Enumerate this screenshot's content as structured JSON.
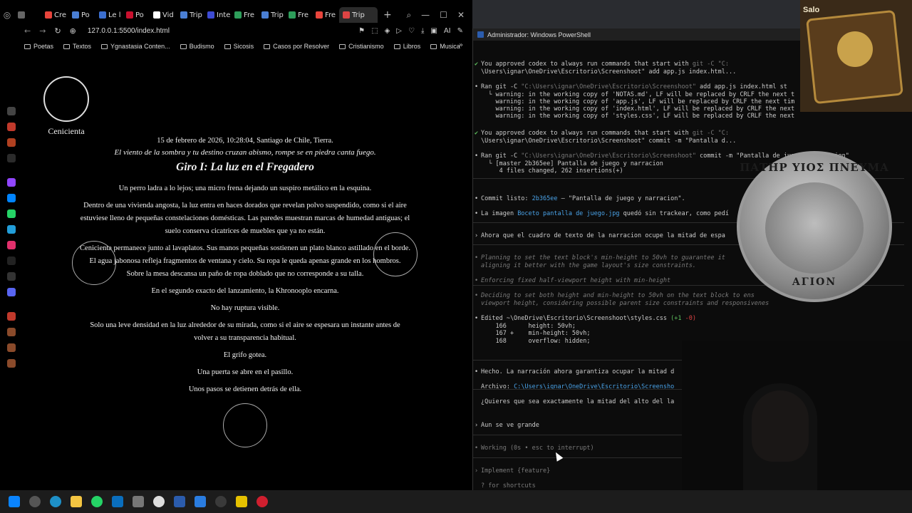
{
  "browser": {
    "tabs": [
      {
        "label": "",
        "color": "#666666"
      },
      {
        "label": "Cre",
        "color": "#e8453c"
      },
      {
        "label": "Po",
        "color": "#4a7fd4"
      },
      {
        "label": "Le l",
        "color": "#3b6fd0"
      },
      {
        "label": "Po",
        "color": "#c8102e"
      },
      {
        "label": "Vid",
        "color": "#ffffff"
      },
      {
        "label": "Trip",
        "color": "#4a7fd4"
      },
      {
        "label": "Inte",
        "color": "#3d4bd4"
      },
      {
        "label": "Fre",
        "color": "#2e9e5b"
      },
      {
        "label": "Trip",
        "color": "#4a7fd4"
      },
      {
        "label": "Fre",
        "color": "#2e9e5b"
      },
      {
        "label": "Fre",
        "color": "#e8453c"
      },
      {
        "label": "Trip",
        "color": "#d44",
        "active": true
      }
    ],
    "url": "127.0.0.1:5500/index.html",
    "nav_ai": "AI",
    "bookmarks": [
      "Poetas",
      "Textos",
      "Ygnastasia Conten...",
      "Budismo",
      "Sicosis",
      "Casos por Resolver",
      "Cristianismo",
      "Libros",
      "Musica"
    ]
  },
  "page": {
    "character_name": "Cenicienta",
    "date": "15 de febrero de 2026, 10:28:04, Santiago de Chile, Tierra.",
    "tagline": "El viento de la sombra y tu destino cruzan abismo, rompe se en piedra canta fuego.",
    "chapter": "Giro I: La luz en el Fregadero",
    "paragraphs": [
      "Un perro ladra a lo lejos; una micro frena dejando un suspiro metálico en la esquina.",
      "Dentro de una vivienda angosta, la luz entra en haces dorados que revelan polvo suspendido, como si el aire estuviese lleno de pequeñas constelaciones domésticas. Las paredes muestran marcas de humedad antiguas; el suelo conserva cicatrices de muebles que ya no están.",
      "Cenicienta permanece junto al lavaplatos. Sus manos pequeñas sostienen un plato blanco astillado en el borde. El agua jabonosa refleja fragmentos de ventana y cielo. Su ropa le queda apenas grande en los hombros. Sobre la mesa descansa un paño de ropa doblado que no corresponde a su talla.",
      "En el segundo exacto del lanzamiento, la Khronooplo encarna.",
      "No hay ruptura visible.",
      "Solo una leve densidad en la luz alrededor de su mirada, como si el aire se espesara un instante antes de volver a su transparencia habitual.",
      "El grifo gotea.",
      "Una puerta se abre en el pasillo.",
      "Unos pasos se detienen detrás de ella."
    ]
  },
  "terminal": {
    "title": "Administrador: Windows PowerShell",
    "card_label": "Salo",
    "coin_top": "ΠΑΤΗΡ ΥΙΟΣ ΠΝΕΥΜΑ",
    "coin_bottom": "ΑΓΙΟΝ",
    "lines": [
      {
        "t": "You approved codex to always run commands that start with ",
        "dim": "git -C \"C:"
      },
      {
        "t": "\\Users\\ignar\\OneDrive\\Escritorio\\Screenshoot\" add app.js index.html..."
      },
      {
        "t": "Ran git -C ",
        "dim": "\"C:\\Users\\ignar\\OneDrive\\Escritorio\\Screenshoot\"",
        "tail": " add app.js index.html st"
      },
      {
        "t": "  └ warning: in the working copy of 'NOTAS.md', LF will be replaced by CRLF the next t"
      },
      {
        "t": "    warning: in the working copy of 'app.js', LF will be replaced by CRLF the next tim"
      },
      {
        "t": "    warning: in the working copy of 'index.html', LF will be replaced by CRLF the next"
      },
      {
        "t": "    warning: in the working copy of 'styles.css', LF will be replaced by CRLF the next"
      },
      {
        "t": "You approved codex to always run commands that start with ",
        "dim": "git -C \"C:"
      },
      {
        "t": "\\Users\\ignar\\OneDrive\\Escritorio\\Screenshoot\" commit -m \"Pantalla d..."
      },
      {
        "t": "Ran git -C ",
        "dim": "\"C:\\Users\\ignar\\OneDrive\\Escritorio\\Screenshoot\"",
        "tail": " commit -m \"Pantalla de juego y narracion\""
      },
      {
        "t": "  └ [master 2b365ee] Pantalla de juego y narracion"
      },
      {
        "t": "     4 files changed, 262 insertions(+)"
      },
      {
        "t": "Commit listo: ",
        "link": "2b365ee",
        "tail": " — \"Pantalla de juego y narracion\"."
      },
      {
        "t": "La imagen ",
        "link": "Boceto pantalla de juego.jpg",
        "tail": " quedó sin trackear, como pedí"
      },
      {
        "t": "Ahora que el cuadro de texto de la narracion ocupe la mitad de espa"
      },
      {
        "t": "Planning to set the text block's min-height to 50vh to guarantee it"
      },
      {
        "t": "aligning it better with the game layout's size constraints."
      },
      {
        "t": "Enforcing fixed half-viewport height with min-height"
      },
      {
        "t": "Deciding to set both height and min-height to 50vh on the text block to ens"
      },
      {
        "t": "viewport height, considering possible parent size constraints and responsivenes"
      },
      {
        "t": "Edited ~\\OneDrive\\Escritorio\\Screenshoot\\styles.css ",
        "plus": "(+1",
        "minus": " -0)"
      },
      {
        "t": "    166      height: 50vh;"
      },
      {
        "t": "    167 +    min-height: 50vh;"
      },
      {
        "t": "    168      overflow: hidden;"
      },
      {
        "t": "Hecho. La narración ahora garantiza ocupar la mitad d"
      },
      {
        "t": "Archivo: ",
        "link": "C:\\Users\\ignar\\OneDrive\\Escritorio\\Screensho"
      },
      {
        "t": "¿Quieres que sea exactamente la mitad del alto del la"
      },
      {
        "t": "Aun se ve grande"
      },
      {
        "t": "Working (0s • esc to interrupt)"
      },
      {
        "t": "Implement {feature}"
      },
      {
        "t": "? for shortcuts"
      }
    ]
  }
}
